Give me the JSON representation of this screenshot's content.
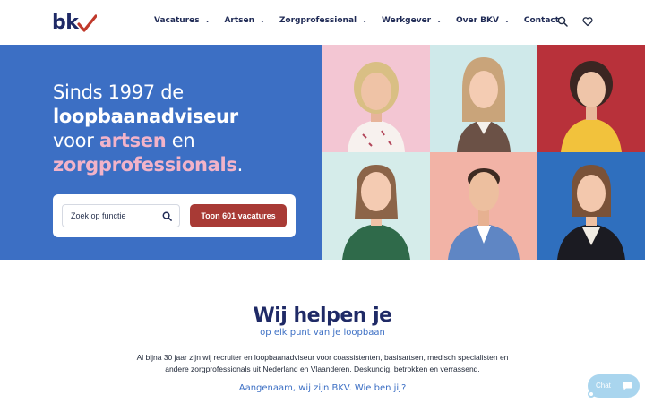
{
  "header": {
    "logo_text": "bk",
    "nav": [
      {
        "label": "Vacatures",
        "has_dropdown": true
      },
      {
        "label": "Artsen",
        "has_dropdown": true
      },
      {
        "label": "Zorgprofessional",
        "has_dropdown": true
      },
      {
        "label": "Werkgever",
        "has_dropdown": true
      },
      {
        "label": "Over BKV",
        "has_dropdown": true
      },
      {
        "label": "Contact",
        "has_dropdown": false
      }
    ],
    "icons": [
      "search-icon",
      "heart-icon"
    ]
  },
  "hero": {
    "line1": "Sinds 1997 de",
    "line2": "loopbaanadviseur",
    "line3_a": "voor ",
    "line3_b": "artsen",
    "line3_c": " en",
    "line4_a": "zorgprofessionals",
    "line4_b": ".",
    "search_placeholder": "Zoek op functie",
    "search_button": "Toon 601 vacatures",
    "photo_backgrounds": [
      "#f3c6d3",
      "#cfe9ea",
      "#b8313a",
      "#d5ecea",
      "#f2b3a6",
      "#2f6fbe"
    ]
  },
  "intro": {
    "title": "Wij helpen je",
    "subtitle": "op elk punt van je loopbaan",
    "body_line1": "Al bijna 30 jaar zijn wij recruiter en loopbaanadviseur voor coassistenten, basisartsen, medisch specialisten en",
    "body_line2": "andere zorgprofessionals uit Nederland en Vlaanderen. Deskundig, betrokken en verrassend.",
    "link": "Aangenaam, wij zijn BKV. Wie ben jij?"
  },
  "chat": {
    "label": "Chat"
  },
  "colors": {
    "brand_blue": "#3c6fc4",
    "navy": "#1f2a66",
    "accent_red": "#a83a35",
    "pink": "#f2b3c9"
  }
}
